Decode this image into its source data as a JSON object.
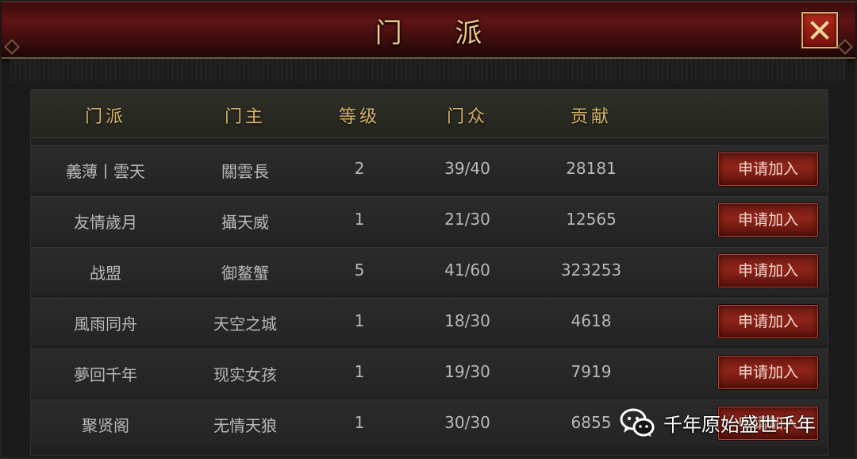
{
  "window": {
    "title": "门 派"
  },
  "table": {
    "headers": [
      "门派",
      "门主",
      "等级",
      "门众",
      "贡献"
    ],
    "rows": [
      {
        "sect": "義薄丨雲天",
        "leader": "關雲長",
        "level": "2",
        "members": "39/40",
        "contribution": "28181",
        "action": "申请加入"
      },
      {
        "sect": "友情歲月",
        "leader": "攝天威",
        "level": "1",
        "members": "21/30",
        "contribution": "12565",
        "action": "申请加入"
      },
      {
        "sect": "战盟",
        "leader": "御鳌蟹",
        "level": "5",
        "members": "41/60",
        "contribution": "323253",
        "action": "申请加入"
      },
      {
        "sect": "風雨同舟",
        "leader": "天空之城",
        "level": "1",
        "members": "18/30",
        "contribution": "4618",
        "action": "申请加入"
      },
      {
        "sect": "夢回千年",
        "leader": "现实女孩",
        "level": "1",
        "members": "19/30",
        "contribution": "7919",
        "action": "申请加入"
      },
      {
        "sect": "聚贤阁",
        "leader": "无情天狼",
        "level": "1",
        "members": "30/30",
        "contribution": "6855",
        "action": "申请加入"
      }
    ]
  },
  "watermark": {
    "text": "千年原始盛世千年",
    "icon": "wechat-icon"
  },
  "colors": {
    "title": "#e8c98a",
    "header_text": "#d6b36a",
    "button": "#8f2419",
    "close": "#b12a1c"
  }
}
